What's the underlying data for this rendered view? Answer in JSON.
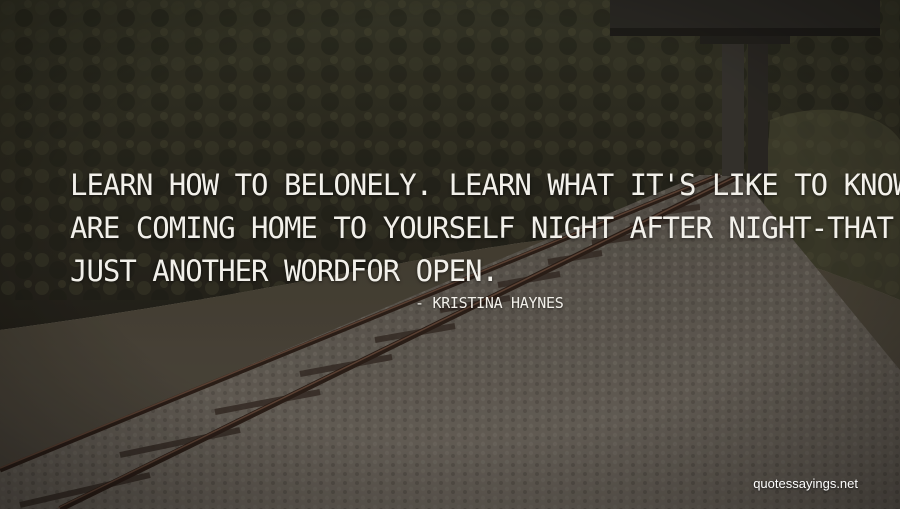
{
  "quote": {
    "lines": [
      "LEARN HOW TO BELONELY. LEARN WHAT IT'S LIKE TO KNOWTHAT YOU",
      "ARE COMING HOME TO YOURSELF NIGHT AFTER NIGHT-THAT EMPTY IS",
      "JUST ANOTHER WORDFOR OPEN."
    ],
    "author": "- KRISTINA HAYNES"
  },
  "watermark": "quotessayings.net",
  "colors": {
    "text": "#f2f0ea",
    "foliage_dark": "#24261b",
    "gravel": "#6e675e",
    "rail": "#3a2a20",
    "sky": "#d9d6c8"
  }
}
